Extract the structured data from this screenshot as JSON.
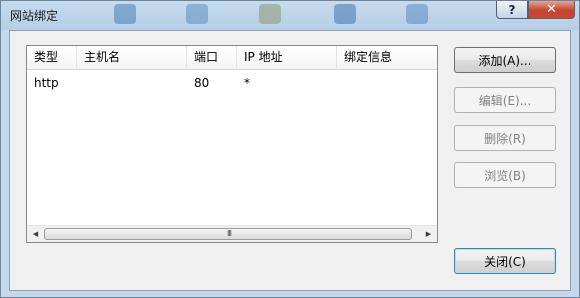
{
  "window": {
    "title": "网站绑定",
    "help_label": "?",
    "close_label": "✕"
  },
  "list": {
    "columns": [
      "类型",
      "主机名",
      "端口",
      "IP 地址",
      "绑定信息"
    ],
    "rows": [
      {
        "type": "http",
        "host": "",
        "port": "80",
        "ip": "*",
        "binding_info": ""
      }
    ],
    "scrollbar": {
      "left_arrow": "◀",
      "right_arrow": "▶",
      "grip": "III"
    }
  },
  "buttons": {
    "add": "添加(A)...",
    "edit": "编辑(E)...",
    "remove": "删除(R)",
    "browse": "浏览(B)",
    "close": "关闭(C)"
  },
  "colors": {
    "frame": "#c4d8ec",
    "close_red": "#c7462e",
    "default_border": "#3c7fb1"
  }
}
